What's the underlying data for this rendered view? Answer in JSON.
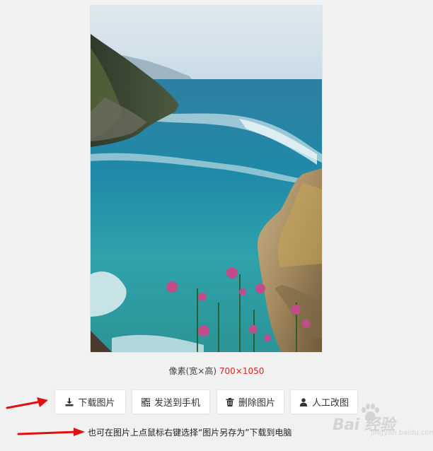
{
  "image": {
    "alt": "海岸风景图片"
  },
  "pixel_info": {
    "label": "像素(宽×高) ",
    "dimensions": "700×1050"
  },
  "buttons": {
    "download": "下载图片",
    "send_to_phone": "发送到手机",
    "delete": "删除图片",
    "manual_edit": "人工改图"
  },
  "hint_text": "也可在图片上点鼠标右键选择“图片另存为”下载到电脑",
  "watermark": {
    "text": "Bai  经验",
    "sub": "jingyan.baidu.com"
  },
  "colors": {
    "background": "#f1f1f1",
    "dimensions_text": "#dd2222",
    "arrow": "#e01010"
  }
}
